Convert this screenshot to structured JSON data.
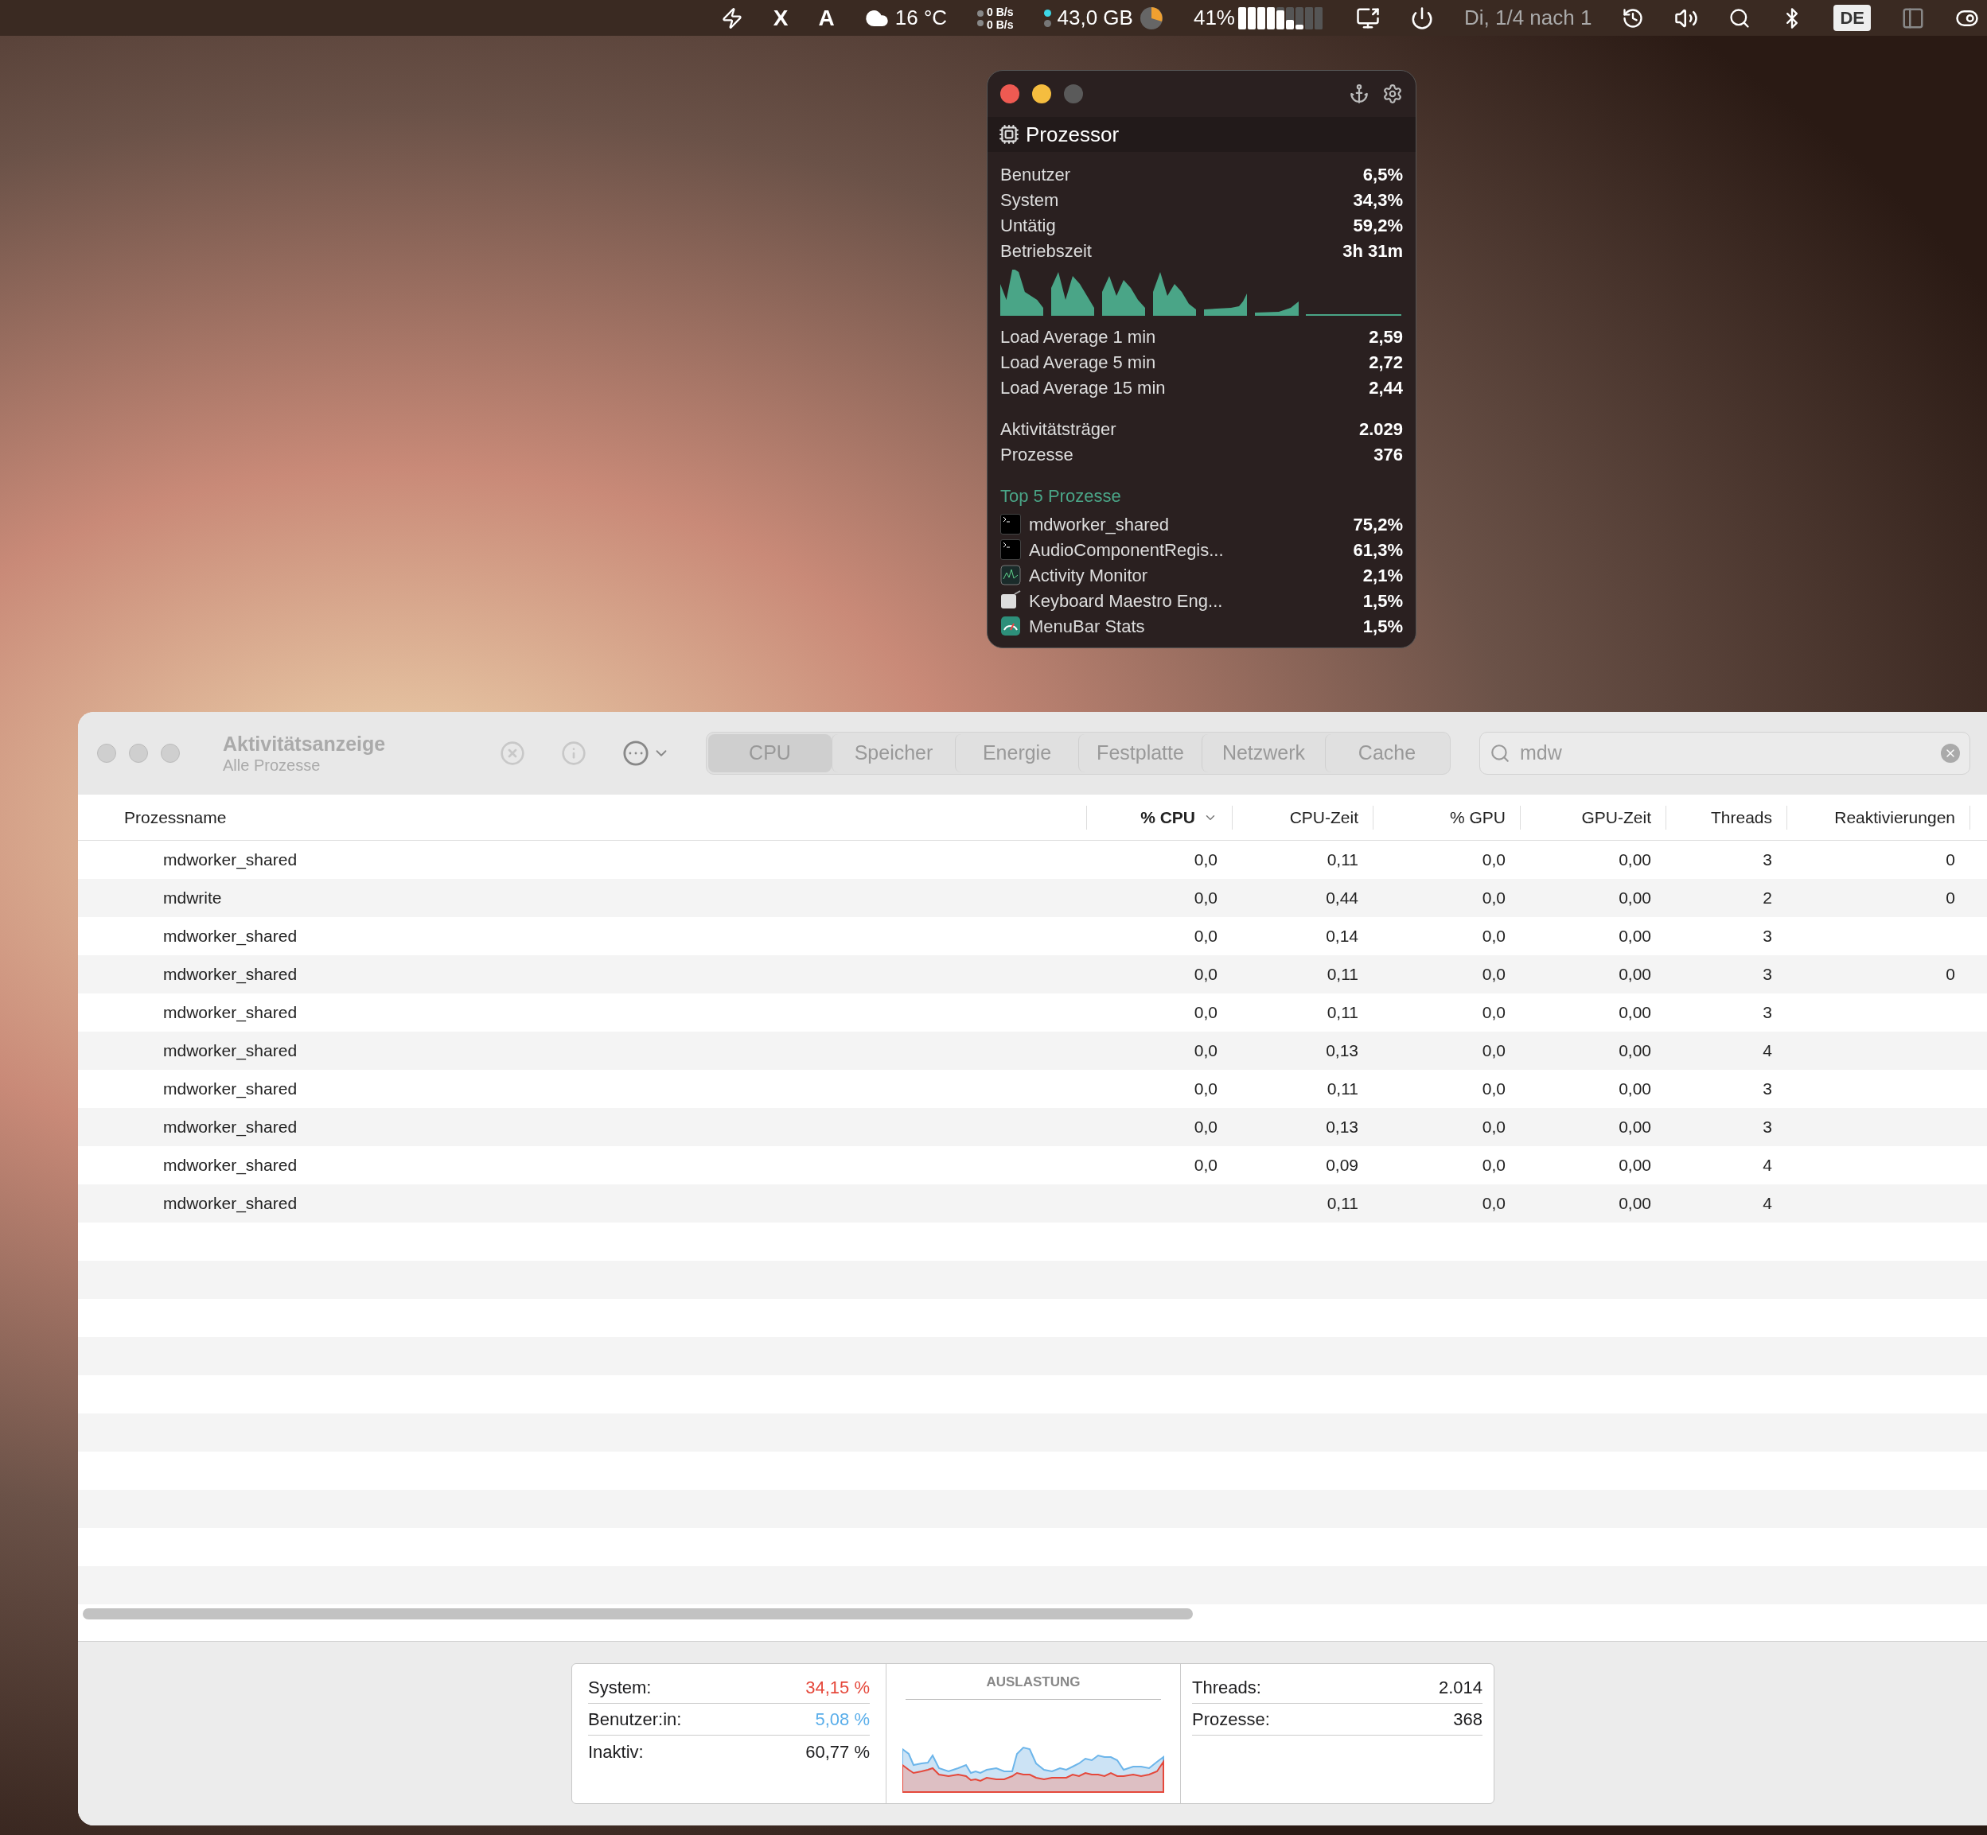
{
  "menu_bar": {
    "items": [
      {
        "kind": "text",
        "text": "X"
      },
      {
        "kind": "text",
        "text": "A"
      },
      {
        "kind": "weather",
        "text": "16 °C"
      },
      {
        "kind": "network",
        "up": "0 B/s",
        "down": "0 B/s"
      },
      {
        "kind": "memory",
        "text": "43,0 GB"
      },
      {
        "kind": "cpu",
        "text": "41%"
      },
      {
        "kind": "date",
        "text": "Di, 1/4 nach 1"
      },
      {
        "kind": "input",
        "text": "DE"
      }
    ]
  },
  "popup": {
    "title": "Prozessor",
    "stats": [
      {
        "label": "Benutzer",
        "value": "6,5%"
      },
      {
        "label": "System",
        "value": "34,3%"
      },
      {
        "label": "Untätig",
        "value": "59,2%"
      },
      {
        "label": "Betriebszeit",
        "value": "3h 31m"
      }
    ],
    "load": [
      {
        "label": "Load Average 1 min",
        "value": "2,59"
      },
      {
        "label": "Load Average 5 min",
        "value": "2,72"
      },
      {
        "label": "Load Average 15 min",
        "value": "2,44"
      }
    ],
    "counts": [
      {
        "label": "Aktivitätsträger",
        "value": "2.029"
      },
      {
        "label": "Prozesse",
        "value": "376"
      }
    ],
    "top_title": "Top 5 Prozesse",
    "top": [
      {
        "kind": "terminal",
        "name": "mdworker_shared",
        "value": "75,2%"
      },
      {
        "kind": "terminal",
        "name": "AudioComponentRegis...",
        "value": "61,3%"
      },
      {
        "kind": "monitor",
        "name": "Activity Monitor",
        "value": "2,1%"
      },
      {
        "kind": "keyboard",
        "name": "Keyboard Maestro Eng...",
        "value": "1,5%"
      },
      {
        "kind": "gauge",
        "name": "MenuBar Stats",
        "value": "1,5%"
      }
    ]
  },
  "window": {
    "title": "Aktivitätsanzeige",
    "subtitle": "Alle Prozesse",
    "tabs": [
      {
        "label": "CPU",
        "selected": true
      },
      {
        "label": "Speicher",
        "selected": false
      },
      {
        "label": "Energie",
        "selected": false
      },
      {
        "label": "Festplatte",
        "selected": false
      },
      {
        "label": "Netzwerk",
        "selected": false
      },
      {
        "label": "Cache",
        "selected": false
      }
    ],
    "search": {
      "value": "mdw"
    },
    "table": {
      "columns": [
        {
          "label": "Prozessname",
          "sorted": false
        },
        {
          "label": "% CPU",
          "sorted": true
        },
        {
          "label": "CPU-Zeit",
          "sorted": false
        },
        {
          "label": "% GPU",
          "sorted": false
        },
        {
          "label": "GPU-Zeit",
          "sorted": false
        },
        {
          "label": "Threads",
          "sorted": false
        },
        {
          "label": "Reaktivierungen",
          "sorted": false
        }
      ],
      "rows": [
        {
          "name": "mdworker_shared",
          "cpu": "0,0",
          "cpu_time": "0,11",
          "gpu": "0,0",
          "gpu_time": "0,00",
          "threads": "3",
          "wakeups": "0"
        },
        {
          "name": "mdwrite",
          "cpu": "0,0",
          "cpu_time": "0,44",
          "gpu": "0,0",
          "gpu_time": "0,00",
          "threads": "2",
          "wakeups": "0"
        },
        {
          "name": "mdworker_shared",
          "cpu": "0,0",
          "cpu_time": "0,14",
          "gpu": "0,0",
          "gpu_time": "0,00",
          "threads": "3"
        },
        {
          "name": "mdworker_shared",
          "cpu": "0,0",
          "cpu_time": "0,11",
          "gpu": "0,0",
          "gpu_time": "0,00",
          "threads": "3",
          "wakeups": "0"
        },
        {
          "name": "mdworker_shared",
          "cpu": "0,0",
          "cpu_time": "0,11",
          "gpu": "0,0",
          "gpu_time": "0,00",
          "threads": "3"
        },
        {
          "name": "mdworker_shared",
          "cpu": "0,0",
          "cpu_time": "0,13",
          "gpu": "0,0",
          "gpu_time": "0,00",
          "threads": "4"
        },
        {
          "name": "mdworker_shared",
          "cpu": "0,0",
          "cpu_time": "0,11",
          "gpu": "0,0",
          "gpu_time": "0,00",
          "threads": "3"
        },
        {
          "name": "mdworker_shared",
          "cpu": "0,0",
          "cpu_time": "0,13",
          "gpu": "0,0",
          "gpu_time": "0,00",
          "threads": "3"
        },
        {
          "name": "mdworker_shared",
          "cpu": "0,0",
          "cpu_time": "0,09",
          "gpu": "0,0",
          "gpu_time": "0,00",
          "threads": "4"
        },
        {
          "name": "mdworker_shared",
          "cpu_time": "0,11",
          "gpu": "0,0",
          "gpu_time": "0,00",
          "threads": "4"
        }
      ]
    },
    "footer": {
      "stats": [
        {
          "label": "System:",
          "value": "34,15 %",
          "color": "#e5483b"
        },
        {
          "label": "Benutzer:in:",
          "value": "5,08 %",
          "color": "#5aaeea"
        },
        {
          "label": "Inaktiv:",
          "value": "60,77 %",
          "color": "#1d1d1f"
        }
      ],
      "chart_title": "AUSLASTUNG",
      "counts": [
        {
          "label": "Threads:",
          "value": "2.014"
        },
        {
          "label": "Prozesse:",
          "value": "368"
        }
      ]
    }
  }
}
